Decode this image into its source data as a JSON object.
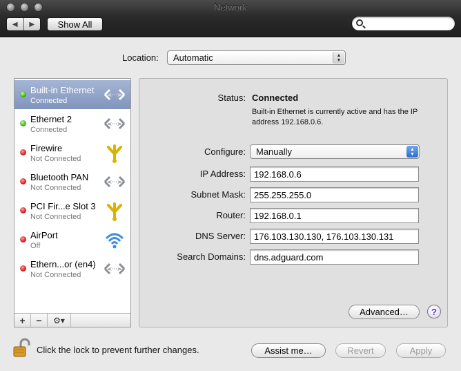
{
  "window": {
    "title": "Network"
  },
  "toolbar": {
    "back_glyph": "◀",
    "forward_glyph": "▶",
    "show_all": "Show All",
    "search_placeholder": ""
  },
  "location": {
    "label": "Location:",
    "value": "Automatic"
  },
  "services": [
    {
      "name": "Built-in Ethernet",
      "status": "Connected",
      "state": "green",
      "icon": "ethernet-icon",
      "selected": true
    },
    {
      "name": "Ethernet 2",
      "status": "Connected",
      "state": "green",
      "icon": "ethernet-icon",
      "selected": false
    },
    {
      "name": "Firewire",
      "status": "Not Connected",
      "state": "red",
      "icon": "firewire-icon",
      "selected": false
    },
    {
      "name": "Bluetooth PAN",
      "status": "Not Connected",
      "state": "red",
      "icon": "ethernet-icon",
      "selected": false
    },
    {
      "name": "PCI Fir...e Slot 3",
      "status": "Not Connected",
      "state": "red",
      "icon": "firewire-icon",
      "selected": false
    },
    {
      "name": "AirPort",
      "status": "Off",
      "state": "red",
      "icon": "wifi-icon",
      "selected": false
    },
    {
      "name": "Ethern...or (en4)",
      "status": "Not Connected",
      "state": "red",
      "icon": "ethernet-icon",
      "selected": false
    }
  ],
  "sidebar_actions": {
    "add": "+",
    "remove": "−",
    "action": "⚙▾"
  },
  "detail": {
    "status_label": "Status:",
    "status_value": "Connected",
    "status_desc": "Built-in Ethernet is currently active and has the IP address 192.168.0.6.",
    "configure_label": "Configure:",
    "configure_value": "Manually",
    "ip_label": "IP Address:",
    "ip_value": "192.168.0.6",
    "subnet_label": "Subnet Mask:",
    "subnet_value": "255.255.255.0",
    "router_label": "Router:",
    "router_value": "192.168.0.1",
    "dns_label": "DNS Server:",
    "dns_value": "176.103.130.130, 176.103.130.131",
    "search_label": "Search Domains:",
    "search_value": "dns.adguard.com",
    "advanced": "Advanced…",
    "help": "?"
  },
  "footer": {
    "lock_text": "Click the lock to prevent further changes.",
    "assist": "Assist me…",
    "revert": "Revert",
    "apply": "Apply"
  },
  "colors": {
    "selection": "#8a9cc2",
    "connected": "#3fb21f",
    "disconnected": "#d91c1c",
    "popup_accent": "#2c6fd1"
  }
}
